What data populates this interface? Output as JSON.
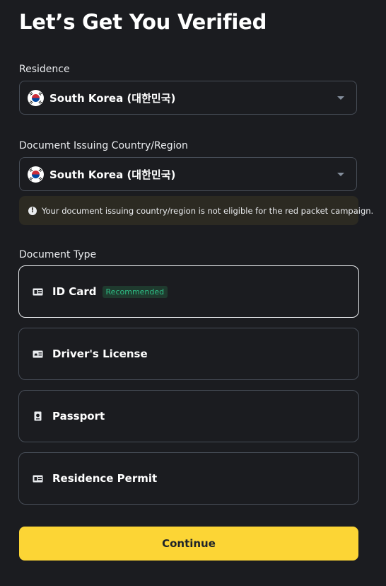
{
  "title": "Let’s Get You Verified",
  "residence": {
    "label": "Residence",
    "value": "South Korea (대한민국)",
    "flag_icon": "south-korea-flag-icon"
  },
  "issuing_country": {
    "label": "Document Issuing Country/Region",
    "value": "South Korea (대한민국)",
    "flag_icon": "south-korea-flag-icon"
  },
  "warning": {
    "text": "Your document issuing country/region is not eligible for the red packet campaign.",
    "icon": "exclamation-circle-icon"
  },
  "document_type": {
    "label": "Document Type",
    "options": [
      {
        "label": "ID Card",
        "badge": "Recommended",
        "icon": "id-card-icon",
        "selected": true
      },
      {
        "label": "Driver's License",
        "icon": "drivers-license-icon",
        "selected": false
      },
      {
        "label": "Passport",
        "icon": "passport-icon",
        "selected": false
      },
      {
        "label": "Residence Permit",
        "icon": "residence-permit-icon",
        "selected": false
      }
    ]
  },
  "continue_label": "Continue",
  "colors": {
    "background": "#1b1c20",
    "accent": "#fcd535",
    "badge_text": "#2ebd85",
    "border": "#474d57"
  }
}
